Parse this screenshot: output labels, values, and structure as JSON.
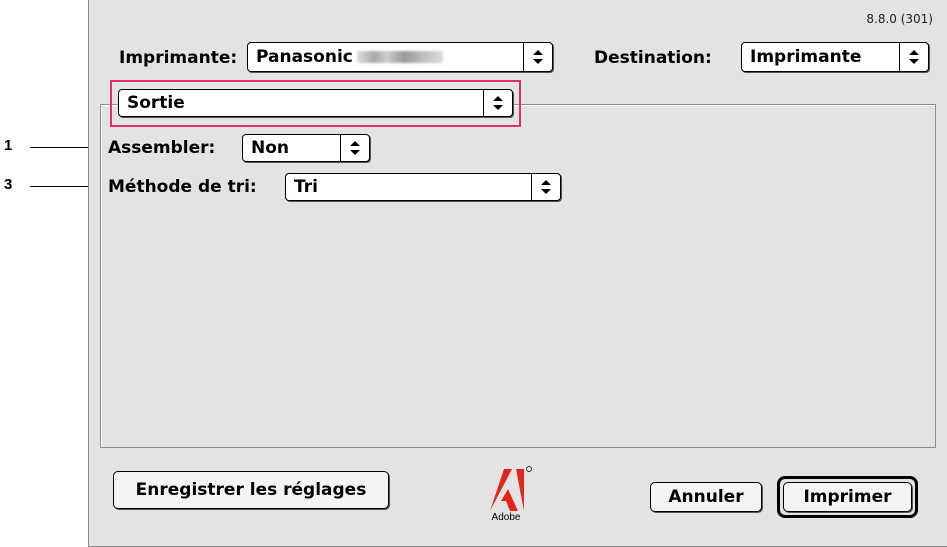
{
  "version": "8.8.0 (301)",
  "printer": {
    "label": "Imprimante:",
    "value": "Panasonic"
  },
  "destination": {
    "label": "Destination:",
    "value": "Imprimante"
  },
  "section": {
    "value": "Sortie"
  },
  "collate": {
    "label": "Assembler:",
    "value": "Non"
  },
  "sort_method": {
    "label": "Méthode de tri:",
    "value": "Tri"
  },
  "callouts": [
    "1",
    "3"
  ],
  "buttons": {
    "save": "Enregistrer les réglages",
    "cancel": "Annuler",
    "print": "Imprimer"
  },
  "logo": {
    "name": "adobe-logo",
    "text": "Adobe",
    "color": "#e1251b"
  },
  "colors": {
    "highlight": "#e0306a",
    "dialog_bg": "#e3e3e3"
  }
}
